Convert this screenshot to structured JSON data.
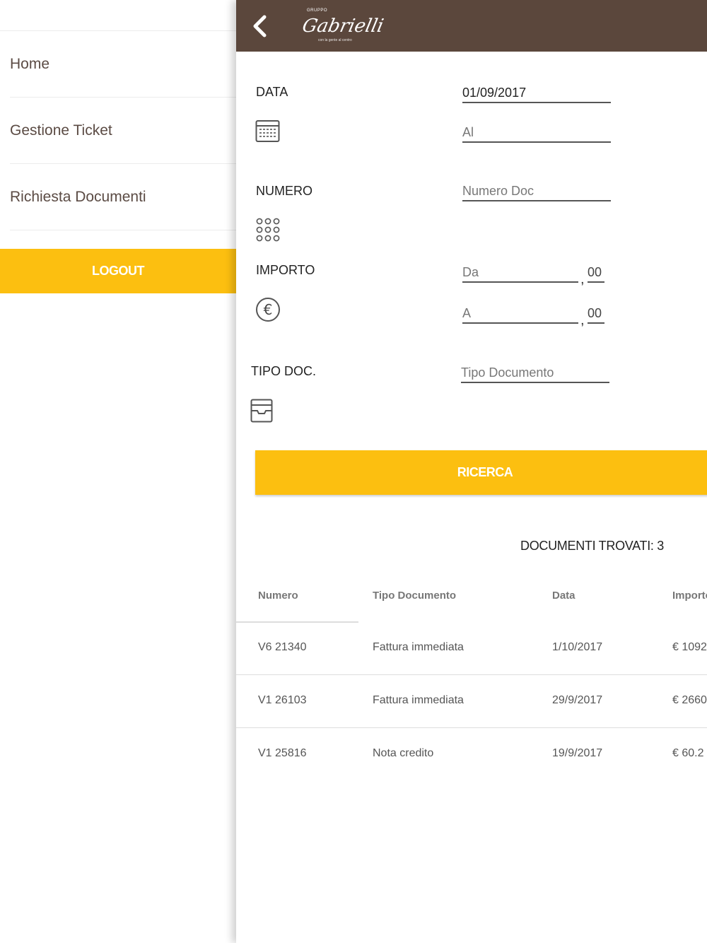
{
  "sidebar": {
    "items": [
      {
        "label": "Home"
      },
      {
        "label": "Gestione Ticket"
      },
      {
        "label": "Richiesta Documenti"
      }
    ],
    "logout_label": "LOGOUT"
  },
  "header": {
    "back_icon": "chevron-left-icon",
    "logo_group": "GRUPPO",
    "logo_name": "Gabrielli",
    "logo_tagline": "con la gente al centro"
  },
  "form": {
    "data": {
      "label": "DATA",
      "from_value": "01/09/2017",
      "to_placeholder": "Al",
      "icon": "calendar-icon"
    },
    "numero": {
      "label": "NUMERO",
      "placeholder": "Numero Doc",
      "icon": "keypad-icon"
    },
    "importo": {
      "label": "IMPORTO",
      "from_placeholder": "Da",
      "to_placeholder": "A",
      "decimal_placeholder": "00",
      "separator": ",",
      "icon": "euro-icon"
    },
    "tipo": {
      "label": "TIPO DOC.",
      "placeholder": "Tipo Documento",
      "icon": "archive-box-icon"
    },
    "search_label": "RICERCA"
  },
  "results": {
    "count_text": "DOCUMENTI TROVATI: 3",
    "columns": [
      "Numero",
      "Tipo Documento",
      "Data",
      "Importo"
    ],
    "rows": [
      {
        "numero": "V6 21340",
        "tipo": "Fattura immediata",
        "data": "1/10/2017",
        "importo": "€ 1092"
      },
      {
        "numero": "V1 26103",
        "tipo": "Fattura immediata",
        "data": "29/9/2017",
        "importo": "€ 2660"
      },
      {
        "numero": "V1 25816",
        "tipo": "Nota credito",
        "data": "19/9/2017",
        "importo": "€ 60.2"
      }
    ]
  },
  "colors": {
    "accent": "#fcbf10",
    "header_bg": "#5b473c",
    "sidebar_text": "#5b4b44"
  }
}
